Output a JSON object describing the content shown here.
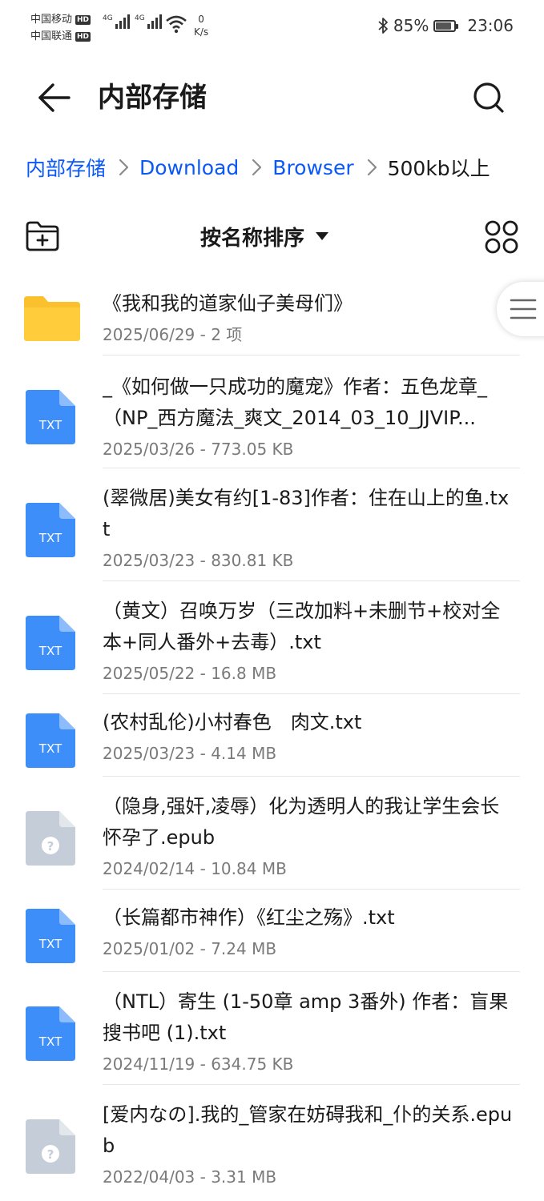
{
  "status": {
    "carrier1": "中国移动",
    "carrier2": "中国联通",
    "hd": "HD",
    "sig1_label": "4G",
    "sig2_label": "4G",
    "speed_value": "0",
    "speed_unit": "K/s",
    "battery": "85%",
    "battery_level_percent": 85,
    "time": "23:06"
  },
  "header": {
    "title": "内部存储"
  },
  "breadcrumb": [
    "内部存储",
    "Download",
    "Browser",
    "500kb以上"
  ],
  "toolbar": {
    "sort_label": "按名称排序"
  },
  "colors": {
    "accent": "#0a59f7",
    "folder": "#fbc02d",
    "txt_icon": "#3d8ef8",
    "unknown_icon": "#c5ced8"
  },
  "files": [
    {
      "type": "folder",
      "name": "《我和我的道家仙子美母们》",
      "meta": "2025/06/29 - 2 项"
    },
    {
      "type": "txt",
      "icon_label": "TXT",
      "name": "_《如何做一只成功的魔宠》作者：五色龙章_（NP_西方魔法_爽文_2014_03_10_JJVIP...",
      "meta": "2025/03/26 - 773.05 KB"
    },
    {
      "type": "txt",
      "icon_label": "TXT",
      "name": "(翠微居)美女有约[1-83]作者：住在山上的鱼.txt",
      "meta": "2025/03/23 - 830.81 KB"
    },
    {
      "type": "txt",
      "icon_label": "TXT",
      "name": "（黄文）召唤万岁（三改加料+未删节+校对全本+同人番外+去毒）.txt",
      "meta": "2025/05/22 - 16.8 MB"
    },
    {
      "type": "txt",
      "icon_label": "TXT",
      "name": "(农村乱伦)小村春色　肉文.txt",
      "meta": "2025/03/23 - 4.14 MB"
    },
    {
      "type": "unknown",
      "icon_label": "?",
      "name": "（隐身,强奸,凌辱）化为透明人的我让学生会长怀孕了.epub",
      "meta": "2024/02/14 - 10.84 MB"
    },
    {
      "type": "txt",
      "icon_label": "TXT",
      "name": "（长篇都市神作）《红尘之殇》.txt",
      "meta": "2025/01/02 - 7.24 MB"
    },
    {
      "type": "txt",
      "icon_label": "TXT",
      "name": "（NTL）寄生 (1-50章 amp 3番外) 作者：盲果 搜书吧 (1).txt",
      "meta": "2024/11/19 - 634.75 KB"
    },
    {
      "type": "unknown",
      "icon_label": "?",
      "name": "[爱内なの].我的_管家在妨碍我和_仆的关系.epub",
      "meta": "2022/04/03 - 3.31 MB"
    }
  ]
}
